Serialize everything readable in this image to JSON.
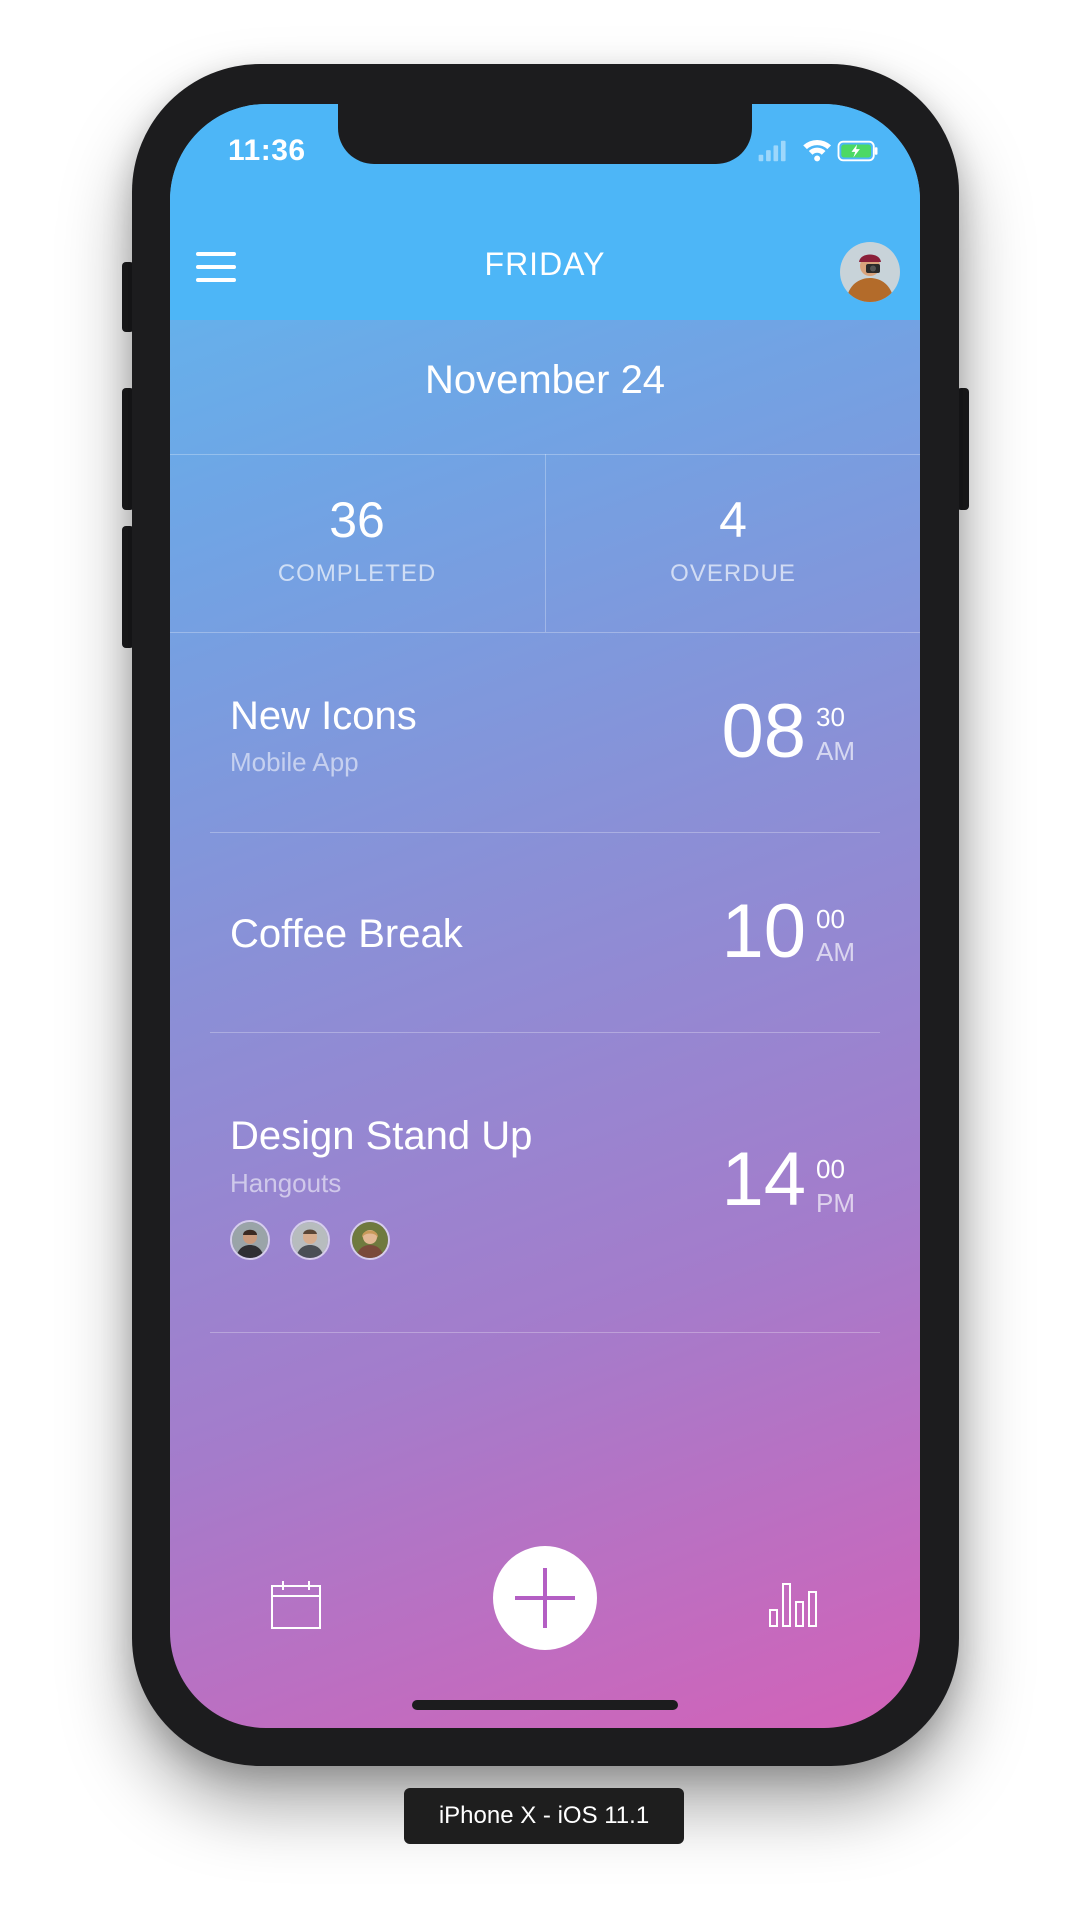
{
  "status_bar": {
    "time": "11:36"
  },
  "header": {
    "title": "FRIDAY"
  },
  "date": "November 24",
  "stats": [
    {
      "value": "36",
      "label": "COMPLETED"
    },
    {
      "value": "4",
      "label": "OVERDUE"
    }
  ],
  "events": [
    {
      "title": "New Icons",
      "subtitle": "Mobile App",
      "hour": "08",
      "minute": "30",
      "ampm": "AM"
    },
    {
      "title": "Coffee Break",
      "subtitle": "",
      "hour": "10",
      "minute": "00",
      "ampm": "AM"
    },
    {
      "title": "Design Stand Up",
      "subtitle": "Hangouts",
      "hour": "14",
      "minute": "00",
      "ampm": "PM",
      "attendee_count": 3
    }
  ],
  "tab_bar": {
    "left_icon": "calendar-icon",
    "center_icon": "plus-icon",
    "right_icon": "bar-chart-icon"
  },
  "device_label": "iPhone X - iOS 11.1",
  "colors": {
    "header": "#4db6f7",
    "gradient_top": "#5cbcf1",
    "gradient_bottom": "#d362b8",
    "accent": "#b45fc4"
  }
}
